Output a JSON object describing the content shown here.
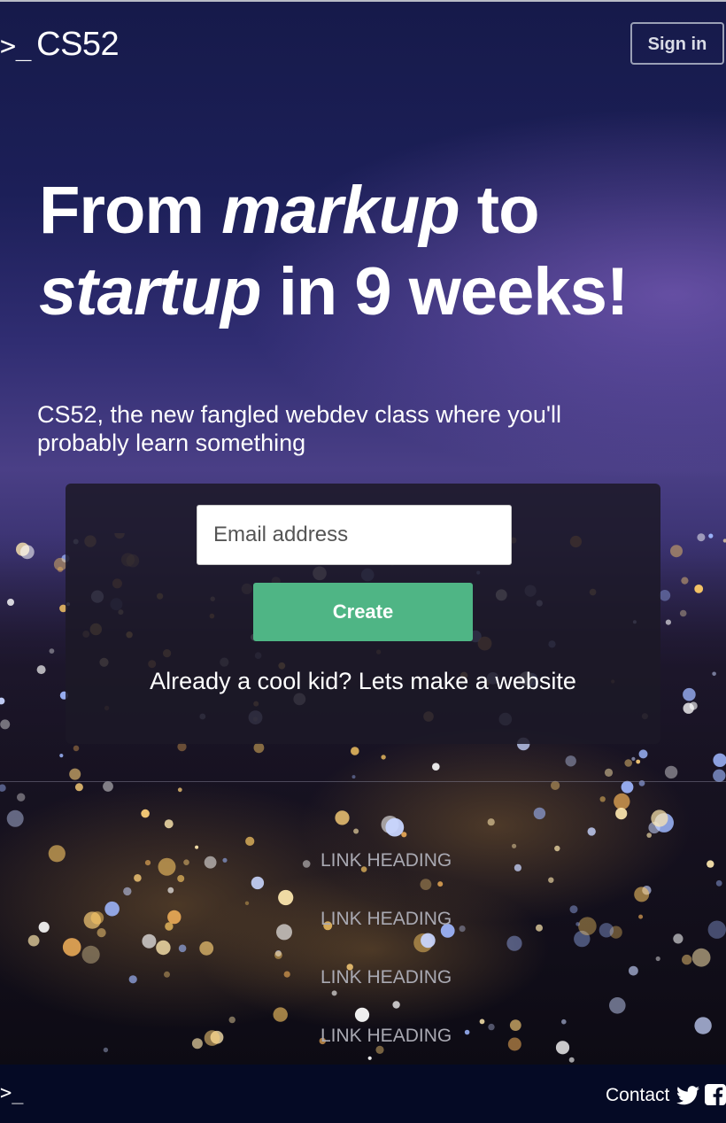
{
  "header": {
    "logo_prompt": ">_",
    "logo_text": "CS52",
    "signin_label": "Sign in"
  },
  "hero": {
    "headline_1": "From ",
    "headline_em_1": "markup",
    "headline_2": " to ",
    "headline_em_2": "startup",
    "headline_3": " in 9 weeks!",
    "subhead": "CS52, the new fangled webdev class where you'll probably learn something"
  },
  "signup": {
    "email_placeholder": "Email address",
    "create_label": "Create",
    "already_text": "Already a cool kid? Lets make a website"
  },
  "links": [
    "LINK HEADING",
    "LINK HEADING",
    "LINK HEADING",
    "LINK HEADING"
  ],
  "footer": {
    "logo_prompt": ">_",
    "contact_label": "Contact",
    "icons": [
      "twitter-icon",
      "facebook-icon"
    ]
  },
  "colors": {
    "accent_green": "#4fb585",
    "footer_bg": "#050a25",
    "link_gray": "#a9a9b2"
  }
}
